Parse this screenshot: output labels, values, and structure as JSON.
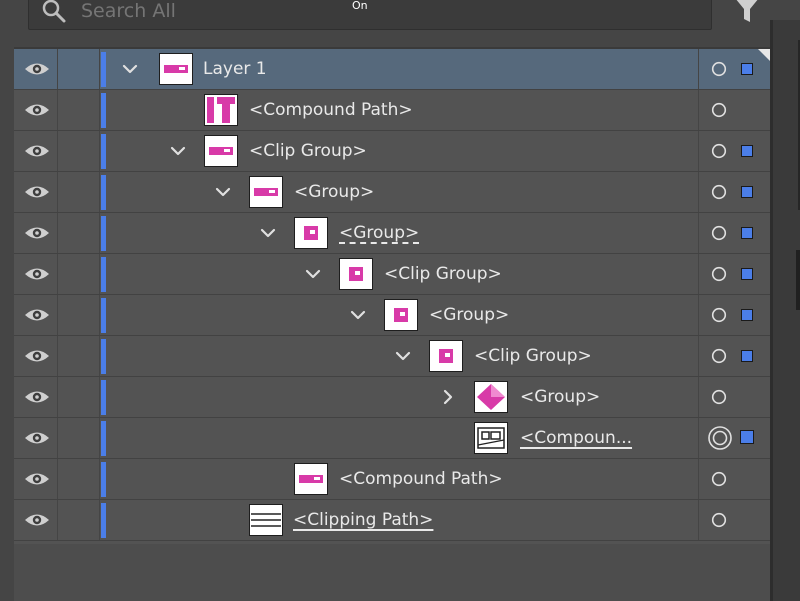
{
  "search": {
    "placeholder": "Search All",
    "on_label": "On"
  },
  "colors": {
    "layer_color": "#4b7ee8",
    "selected_row": "#56697c",
    "panel_bg": "#535353",
    "thumb_art": "#d83aa8"
  },
  "layers": [
    {
      "label": "Layer 1",
      "thumb": "layer",
      "toggle": "expanded",
      "selected": true,
      "target": "ring",
      "sel_indicator": true,
      "corner_marker": true
    },
    {
      "label": "<Compound Path>",
      "thumb": "it-text",
      "toggle": "none",
      "target": "ring",
      "sel_indicator": false
    },
    {
      "label": "<Clip Group>",
      "thumb": "layer",
      "toggle": "expanded",
      "target": "ring",
      "sel_indicator": true
    },
    {
      "label": "<Group>",
      "thumb": "layer",
      "toggle": "expanded",
      "target": "ring",
      "sel_indicator": true
    },
    {
      "label": "<Group>",
      "thumb": "small-pink",
      "toggle": "expanded",
      "target": "ring",
      "sel_indicator": true,
      "underline": "dashed"
    },
    {
      "label": "<Clip Group>",
      "thumb": "small-pink",
      "toggle": "expanded",
      "target": "ring",
      "sel_indicator": true
    },
    {
      "label": "<Group>",
      "thumb": "small-pink",
      "toggle": "expanded",
      "target": "ring",
      "sel_indicator": true
    },
    {
      "label": "<Clip Group>",
      "thumb": "small-pink",
      "toggle": "expanded",
      "target": "ring",
      "sel_indicator": true
    },
    {
      "label": "<Group>",
      "thumb": "diamond",
      "toggle": "collapsed",
      "target": "ring",
      "sel_indicator": false
    },
    {
      "label": "<Compoun...",
      "thumb": "outline-art",
      "toggle": "none",
      "target": "double-ring",
      "sel_indicator": true,
      "underline": "solid"
    },
    {
      "label": "<Compound Path>",
      "thumb": "layer",
      "toggle": "none",
      "target": "ring",
      "sel_indicator": false
    },
    {
      "label": "<Clipping Path>",
      "thumb": "lines",
      "toggle": "none",
      "target": "ring",
      "sel_indicator": false,
      "underline": "solid"
    }
  ]
}
